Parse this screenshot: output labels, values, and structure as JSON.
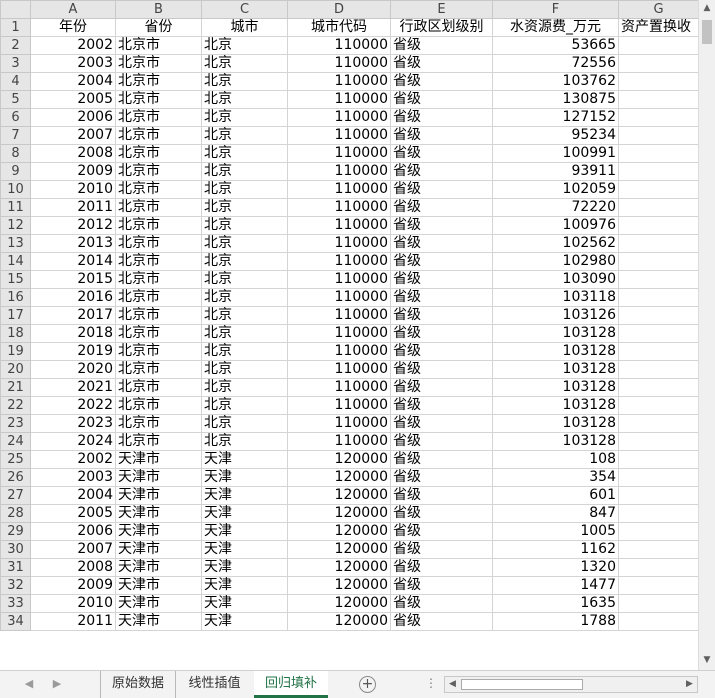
{
  "columns": [
    "A",
    "B",
    "C",
    "D",
    "E",
    "F",
    "G"
  ],
  "header_row": {
    "row": "1",
    "cells": [
      "年份",
      "省份",
      "城市",
      "城市代码",
      "行政区划级别",
      "水资源费_万元",
      "资产置换收"
    ]
  },
  "rows": [
    {
      "n": "2",
      "year": "2002",
      "prov": "北京市",
      "city": "北京",
      "code": "110000",
      "level": "省级",
      "fee": "53665"
    },
    {
      "n": "3",
      "year": "2003",
      "prov": "北京市",
      "city": "北京",
      "code": "110000",
      "level": "省级",
      "fee": "72556"
    },
    {
      "n": "4",
      "year": "2004",
      "prov": "北京市",
      "city": "北京",
      "code": "110000",
      "level": "省级",
      "fee": "103762"
    },
    {
      "n": "5",
      "year": "2005",
      "prov": "北京市",
      "city": "北京",
      "code": "110000",
      "level": "省级",
      "fee": "130875"
    },
    {
      "n": "6",
      "year": "2006",
      "prov": "北京市",
      "city": "北京",
      "code": "110000",
      "level": "省级",
      "fee": "127152"
    },
    {
      "n": "7",
      "year": "2007",
      "prov": "北京市",
      "city": "北京",
      "code": "110000",
      "level": "省级",
      "fee": "95234"
    },
    {
      "n": "8",
      "year": "2008",
      "prov": "北京市",
      "city": "北京",
      "code": "110000",
      "level": "省级",
      "fee": "100991"
    },
    {
      "n": "9",
      "year": "2009",
      "prov": "北京市",
      "city": "北京",
      "code": "110000",
      "level": "省级",
      "fee": "93911"
    },
    {
      "n": "10",
      "year": "2010",
      "prov": "北京市",
      "city": "北京",
      "code": "110000",
      "level": "省级",
      "fee": "102059"
    },
    {
      "n": "11",
      "year": "2011",
      "prov": "北京市",
      "city": "北京",
      "code": "110000",
      "level": "省级",
      "fee": "72220"
    },
    {
      "n": "12",
      "year": "2012",
      "prov": "北京市",
      "city": "北京",
      "code": "110000",
      "level": "省级",
      "fee": "100976"
    },
    {
      "n": "13",
      "year": "2013",
      "prov": "北京市",
      "city": "北京",
      "code": "110000",
      "level": "省级",
      "fee": "102562"
    },
    {
      "n": "14",
      "year": "2014",
      "prov": "北京市",
      "city": "北京",
      "code": "110000",
      "level": "省级",
      "fee": "102980"
    },
    {
      "n": "15",
      "year": "2015",
      "prov": "北京市",
      "city": "北京",
      "code": "110000",
      "level": "省级",
      "fee": "103090"
    },
    {
      "n": "16",
      "year": "2016",
      "prov": "北京市",
      "city": "北京",
      "code": "110000",
      "level": "省级",
      "fee": "103118"
    },
    {
      "n": "17",
      "year": "2017",
      "prov": "北京市",
      "city": "北京",
      "code": "110000",
      "level": "省级",
      "fee": "103126"
    },
    {
      "n": "18",
      "year": "2018",
      "prov": "北京市",
      "city": "北京",
      "code": "110000",
      "level": "省级",
      "fee": "103128"
    },
    {
      "n": "19",
      "year": "2019",
      "prov": "北京市",
      "city": "北京",
      "code": "110000",
      "level": "省级",
      "fee": "103128"
    },
    {
      "n": "20",
      "year": "2020",
      "prov": "北京市",
      "city": "北京",
      "code": "110000",
      "level": "省级",
      "fee": "103128"
    },
    {
      "n": "21",
      "year": "2021",
      "prov": "北京市",
      "city": "北京",
      "code": "110000",
      "level": "省级",
      "fee": "103128"
    },
    {
      "n": "22",
      "year": "2022",
      "prov": "北京市",
      "city": "北京",
      "code": "110000",
      "level": "省级",
      "fee": "103128"
    },
    {
      "n": "23",
      "year": "2023",
      "prov": "北京市",
      "city": "北京",
      "code": "110000",
      "level": "省级",
      "fee": "103128"
    },
    {
      "n": "24",
      "year": "2024",
      "prov": "北京市",
      "city": "北京",
      "code": "110000",
      "level": "省级",
      "fee": "103128"
    },
    {
      "n": "25",
      "year": "2002",
      "prov": "天津市",
      "city": "天津",
      "code": "120000",
      "level": "省级",
      "fee": "108"
    },
    {
      "n": "26",
      "year": "2003",
      "prov": "天津市",
      "city": "天津",
      "code": "120000",
      "level": "省级",
      "fee": "354"
    },
    {
      "n": "27",
      "year": "2004",
      "prov": "天津市",
      "city": "天津",
      "code": "120000",
      "level": "省级",
      "fee": "601"
    },
    {
      "n": "28",
      "year": "2005",
      "prov": "天津市",
      "city": "天津",
      "code": "120000",
      "level": "省级",
      "fee": "847"
    },
    {
      "n": "29",
      "year": "2006",
      "prov": "天津市",
      "city": "天津",
      "code": "120000",
      "level": "省级",
      "fee": "1005"
    },
    {
      "n": "30",
      "year": "2007",
      "prov": "天津市",
      "city": "天津",
      "code": "120000",
      "level": "省级",
      "fee": "1162"
    },
    {
      "n": "31",
      "year": "2008",
      "prov": "天津市",
      "city": "天津",
      "code": "120000",
      "level": "省级",
      "fee": "1320"
    },
    {
      "n": "32",
      "year": "2009",
      "prov": "天津市",
      "city": "天津",
      "code": "120000",
      "level": "省级",
      "fee": "1477"
    },
    {
      "n": "33",
      "year": "2010",
      "prov": "天津市",
      "city": "天津",
      "code": "120000",
      "level": "省级",
      "fee": "1635"
    },
    {
      "n": "34",
      "year": "2011",
      "prov": "天津市",
      "city": "天津",
      "code": "120000",
      "level": "省级",
      "fee": "1788"
    }
  ],
  "sheet_tabs": [
    {
      "label": "原始数据",
      "active": false
    },
    {
      "label": "线性插值",
      "active": false
    },
    {
      "label": "回归填补",
      "active": true
    }
  ],
  "add_sheet_label": "+",
  "tab_overflow_label": "⋮",
  "colors": {
    "accent": "#217346",
    "header_bg": "#e6e6e6",
    "grid": "#d4d4d4"
  },
  "icons": {
    "nav_prev": "chevron-left-icon",
    "nav_next": "chevron-right-icon",
    "add": "plus-circle-icon"
  }
}
